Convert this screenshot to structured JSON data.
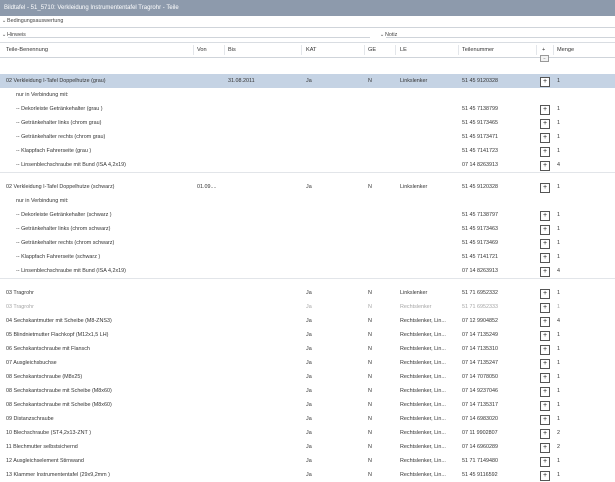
{
  "window": {
    "title": "Bildtafel - 51_5710: Verkleidung Instrumententafel Tragrohr - Teile"
  },
  "sections": {
    "bedingung": "Bedingungsauswertung",
    "hinweis": "Hinweis",
    "notiz": "Notiz"
  },
  "columns": {
    "name": "Teile-Benennung",
    "von": "Von",
    "bis": "Bis",
    "kat": "KAT",
    "ge": "GE",
    "le": "LE",
    "nummer": "Teilenummer",
    "plus": "+",
    "menge": "Menge"
  },
  "rows": [
    {
      "name": "02 Verkleidung I-Tafel Doppelhutze (grau)",
      "von": "",
      "bis": "31.08.2011",
      "kat": "Ja",
      "ge": "N",
      "le": "Linkslenker",
      "nummer": "51 45 9120328",
      "menge": "1"
    },
    {
      "name": "nur in Verbindung mit:",
      "von": "",
      "bis": "",
      "kat": "",
      "ge": "",
      "le": "",
      "nummer": "",
      "menge": ""
    },
    {
      "name": "-- Dekorleiste Getränkehalter (grau )",
      "von": "",
      "bis": "",
      "kat": "",
      "ge": "",
      "le": "",
      "nummer": "51 45 7138799",
      "menge": "1"
    },
    {
      "name": "-- Getränkehalter links (chrom grau)",
      "von": "",
      "bis": "",
      "kat": "",
      "ge": "",
      "le": "",
      "nummer": "51 45 9173465",
      "menge": "1"
    },
    {
      "name": "-- Getränkehalter rechts (chrom grau)",
      "von": "",
      "bis": "",
      "kat": "",
      "ge": "",
      "le": "",
      "nummer": "51 45 9173471",
      "menge": "1"
    },
    {
      "name": "-- Klappfach Fahrerseite (grau )",
      "von": "",
      "bis": "",
      "kat": "",
      "ge": "",
      "le": "",
      "nummer": "51 45 7141723",
      "menge": "1"
    },
    {
      "name": "-- Linsenblechschraube mit Bund (ISA 4,2x19)",
      "von": "",
      "bis": "",
      "kat": "",
      "ge": "",
      "le": "",
      "nummer": "07 14 8263913",
      "menge": "4"
    },
    {
      "name": "02 Verkleidung I-Tafel Doppelhutze (schwarz)",
      "von": "01.09....",
      "bis": "",
      "kat": "Ja",
      "ge": "N",
      "le": "Linkslenker",
      "nummer": "51 45 9120328",
      "menge": "1"
    },
    {
      "name": "nur in Verbindung mit:",
      "von": "",
      "bis": "",
      "kat": "",
      "ge": "",
      "le": "",
      "nummer": "",
      "menge": ""
    },
    {
      "name": "-- Dekorleiste Getränkehalter (schwarz )",
      "von": "",
      "bis": "",
      "kat": "",
      "ge": "",
      "le": "",
      "nummer": "51 45 7138797",
      "menge": "1"
    },
    {
      "name": "-- Getränkehalter links (chrom schwarz)",
      "von": "",
      "bis": "",
      "kat": "",
      "ge": "",
      "le": "",
      "nummer": "51 45 9173463",
      "menge": "1"
    },
    {
      "name": "-- Getränkehalter rechts (chrom schwarz)",
      "von": "",
      "bis": "",
      "kat": "",
      "ge": "",
      "le": "",
      "nummer": "51 45 9173469",
      "menge": "1"
    },
    {
      "name": "-- Klappfach Fahrerseite (schwarz )",
      "von": "",
      "bis": "",
      "kat": "",
      "ge": "",
      "le": "",
      "nummer": "51 45 7141721",
      "menge": "1"
    },
    {
      "name": "-- Linsenblechschraube mit Bund (ISA 4,2x19)",
      "von": "",
      "bis": "",
      "kat": "",
      "ge": "",
      "le": "",
      "nummer": "07 14 8263913",
      "menge": "4"
    },
    {
      "name": "03 Tragrohr",
      "von": "",
      "bis": "",
      "kat": "Ja",
      "ge": "N",
      "le": "Linkslenker",
      "nummer": "51 71 6952332",
      "menge": "1"
    },
    {
      "name": "03 Tragrohr",
      "von": "",
      "bis": "",
      "kat": "Ja",
      "ge": "N",
      "le": "Rechtslenker",
      "nummer": "51 71 6952333",
      "menge": "1"
    },
    {
      "name": "04 Sechskantmutter mit Scheibe (M8-ZNS3)",
      "von": "",
      "bis": "",
      "kat": "Ja",
      "ge": "N",
      "le": "Rechtslenker, Lin...",
      "nummer": "07 12 9904852",
      "menge": "4"
    },
    {
      "name": "05 Blindnietmutter Flachkopf (M12x1,5 LH)",
      "von": "",
      "bis": "",
      "kat": "Ja",
      "ge": "N",
      "le": "Rechtslenker, Lin...",
      "nummer": "07 14 7135249",
      "menge": "1"
    },
    {
      "name": "06 Sechskantschraube mit Flansch",
      "von": "",
      "bis": "",
      "kat": "Ja",
      "ge": "N",
      "le": "Rechtslenker, Lin...",
      "nummer": "07 14 7135310",
      "menge": "1"
    },
    {
      "name": "07 Ausgleichsbuchse",
      "von": "",
      "bis": "",
      "kat": "Ja",
      "ge": "N",
      "le": "Rechtslenker, Lin...",
      "nummer": "07 14 7135247",
      "menge": "1"
    },
    {
      "name": "08 Sechskantschraube (M8x25)",
      "von": "",
      "bis": "",
      "kat": "Ja",
      "ge": "N",
      "le": "Rechtslenker, Lin...",
      "nummer": "07 14 7078050",
      "menge": "1"
    },
    {
      "name": "08 Sechskantschraube mit Scheibe (M8x60)",
      "von": "",
      "bis": "",
      "kat": "Ja",
      "ge": "N",
      "le": "Rechtslenker, Lin...",
      "nummer": "07 14 9237046",
      "menge": "1"
    },
    {
      "name": "08 Sechskantschraube mit Scheibe (M8x60)",
      "von": "",
      "bis": "",
      "kat": "Ja",
      "ge": "N",
      "le": "Rechtslenker, Lin...",
      "nummer": "07 14 7135317",
      "menge": "1"
    },
    {
      "name": "09 Distanzschraube",
      "von": "",
      "bis": "",
      "kat": "Ja",
      "ge": "N",
      "le": "Rechtslenker, Lin...",
      "nummer": "07 14 6983020",
      "menge": "1"
    },
    {
      "name": "10 Blechschraube (ST4,2x13-ZNT )",
      "von": "",
      "bis": "",
      "kat": "Ja",
      "ge": "N",
      "le": "Rechtslenker, Lin...",
      "nummer": "07 11 9902807",
      "menge": "2"
    },
    {
      "name": "11 Blechmutter selbstsichernd",
      "von": "",
      "bis": "",
      "kat": "Ja",
      "ge": "N",
      "le": "Rechtslenker, Lin...",
      "nummer": "07 14 6960289",
      "menge": "2"
    },
    {
      "name": "12 Ausgleichselement Stirnwand",
      "von": "",
      "bis": "",
      "kat": "Ja",
      "ge": "N",
      "le": "Rechtslenker, Lin...",
      "nummer": "51 71 7149480",
      "menge": "1"
    },
    {
      "name": "13 Klammer Instrumententafel (29x9,2mm )",
      "von": "",
      "bis": "",
      "kat": "Ja",
      "ge": "N",
      "le": "Rechtslenker, Lin...",
      "nummer": "51 45 9116592",
      "menge": "1"
    }
  ]
}
